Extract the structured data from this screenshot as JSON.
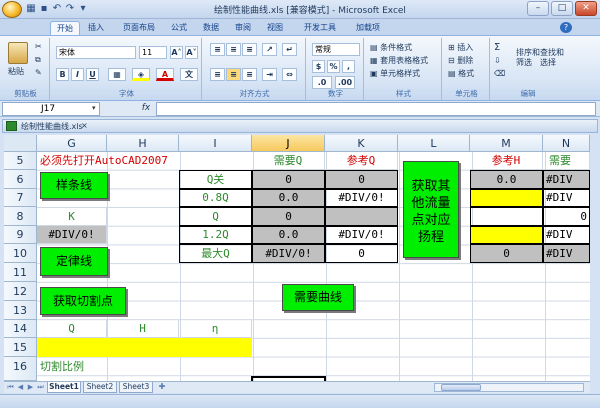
{
  "window": {
    "title": "绘制性能曲线.xls  [兼容模式] - Microsoft Excel",
    "minimize": "–",
    "maximize": "□",
    "close": "✕"
  },
  "ribbon_tabs": [
    "开始",
    "插入",
    "页面布局",
    "公式",
    "数据",
    "审阅",
    "视图",
    "开发工具",
    "加载项"
  ],
  "ribbon": {
    "clipboard": {
      "paste": "粘贴",
      "label": "剪贴板"
    },
    "font": {
      "name": "宋体",
      "size": "11",
      "label": "字体",
      "bold": "B",
      "italic": "I",
      "underline": "U",
      "grow": "A˄",
      "shrink": "A˅"
    },
    "alignment": {
      "label": "对齐方式"
    },
    "number": {
      "format": "常规",
      "label": "数字",
      "percent": "%",
      "comma": ","
    },
    "styles": {
      "conditional": "条件格式",
      "table": "套用表格格式",
      "cell": "单元格样式",
      "label": "样式"
    },
    "cells": {
      "insert": "插入",
      "delete": "删除",
      "format": "格式",
      "label": "单元格"
    },
    "editing": {
      "sum": "Σ",
      "sort": "排序和",
      "sort2": "筛选",
      "find": "查找和",
      "find2": "选择",
      "label": "编辑"
    }
  },
  "formula_bar": {
    "name_box": "J17",
    "fx": "fx",
    "content": ""
  },
  "workbook_tab": "绘制性能曲线.xls",
  "columns": [
    "G",
    "H",
    "I",
    "J",
    "K",
    "L",
    "M",
    "N"
  ],
  "rows": [
    "5",
    "6",
    "7",
    "8",
    "9",
    "10",
    "11",
    "12",
    "13",
    "14",
    "15",
    "16"
  ],
  "cells": {
    "g5": "必须先打开AutoCAD2007",
    "j5": "需要Q",
    "k5": "参考Q",
    "m5": "参考H",
    "n5": "需要",
    "i6": "Q关",
    "j6": "0",
    "k6": "0",
    "m6": "0.0",
    "n6": "#DIV",
    "i7": "0.8Q",
    "j7": "0.0",
    "k7": "#DIV/0!",
    "n7": "#DIV",
    "g8": "K",
    "i8": "Q",
    "j8": "0",
    "n8": "0",
    "g9": "#DIV/0!",
    "i9": "1.2Q",
    "j9": "0.0",
    "k9": "#DIV/0!",
    "n9": "#DIV",
    "i10": "最大Q",
    "j10": "#DIV/0!",
    "k10": "0",
    "m10": "0",
    "n10": "#DIV",
    "g14": "Q",
    "h14": "H",
    "i14": "η",
    "g16": "切割比例"
  },
  "buttons": {
    "spline": "样条线",
    "law_line": "定律线",
    "get_cut_point": "获取切割点",
    "required_curve": "需要曲线",
    "get_other_flow": "获取其他流量点对应扬程"
  },
  "sheet_tabs": [
    "Sheet1",
    "Sheet2",
    "Sheet3"
  ],
  "colors": {
    "green_button": "#00ee00",
    "yellow": "#ffff00",
    "gray": "#c0c0c0",
    "red_text": "#d40000",
    "green_text": "#2d8a2d"
  }
}
